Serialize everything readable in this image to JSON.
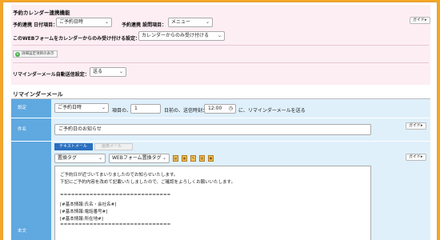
{
  "calendar": {
    "section_title": "予約カレンダー連携機能",
    "date_item_label": "予約連携 日付項目：",
    "date_item_value": "ご予約日時",
    "setting_item_label": "予約連携 設問項目：",
    "setting_item_value": "メニュー",
    "accept_label": "このWEBフォームをカレンダーからのみ受け付ける設定：",
    "accept_value": "カレンダーからのみ受け付ける",
    "detail_button": "詳細設定項目の表示",
    "reminder_auto_label": "リマインダーメール自動送信設定：",
    "reminder_auto_value": "送る",
    "guide_label": "ガイド▸"
  },
  "reminder": {
    "section_title": "リマインダーメール",
    "settings": {
      "label": "設定",
      "item_select": "ご予約日時",
      "text_item": "項目の、",
      "days_value": "1",
      "text_days": "日前の、送信時刻：",
      "time_value": "12:00",
      "text_after": "に、リマインダーメールを送る"
    },
    "subject": {
      "label": "件名",
      "value": "ご予約日のお知らせ",
      "guide_label": "ガイド▸"
    },
    "body": {
      "label": "本文",
      "tab_text": "テキストメール",
      "tab_html": "画像メール",
      "insert_tag_select": "置換タグ",
      "webform_tag_select": "WEBフォーム置換タグ",
      "guide_label": "ガイド▸",
      "lines": [
        "ご予約日が近づいてまいりましたのでお知らせいたします。",
        "下記にご予約内容を改めて記載いたしましたので、ご確認をよろしくお願いいたします。",
        "",
        "==============================",
        "[#基本情報:氏名・会社名#]",
        "[#基本情報:電話番号#]",
        "[#基本情報:所在地#]",
        "=============================="
      ]
    }
  }
}
